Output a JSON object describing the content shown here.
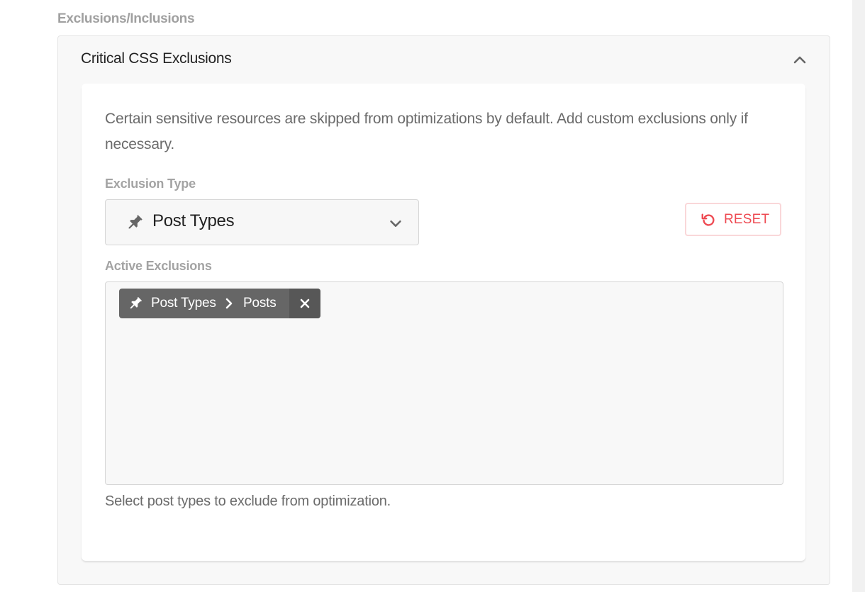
{
  "section": {
    "heading": "Exclusions/Inclusions"
  },
  "accordion": {
    "title": "Critical CSS Exclusions",
    "collapse_icon": "chevron-up-icon"
  },
  "card": {
    "description": "Certain sensitive resources are skipped from optimizations by default. Add custom exclusions only if necessary.",
    "exclusion_type": {
      "label": "Exclusion Type",
      "icon": "pin-icon",
      "selected": "Post Types"
    },
    "reset_button": {
      "label": "RESET",
      "icon": "undo-icon"
    },
    "active_exclusions": {
      "label": "Active Exclusions",
      "tags": [
        {
          "icon": "pin-icon",
          "group": "Post Types",
          "separator_icon": "chevron-right-icon",
          "value": "Posts",
          "remove_icon": "close-icon"
        }
      ]
    },
    "helper_text": "Select post types to exclude from optimization."
  },
  "colors": {
    "reset_accent": "#ee4a52",
    "tag_background": "#666666",
    "heading_gray": "#a0a0a0"
  }
}
